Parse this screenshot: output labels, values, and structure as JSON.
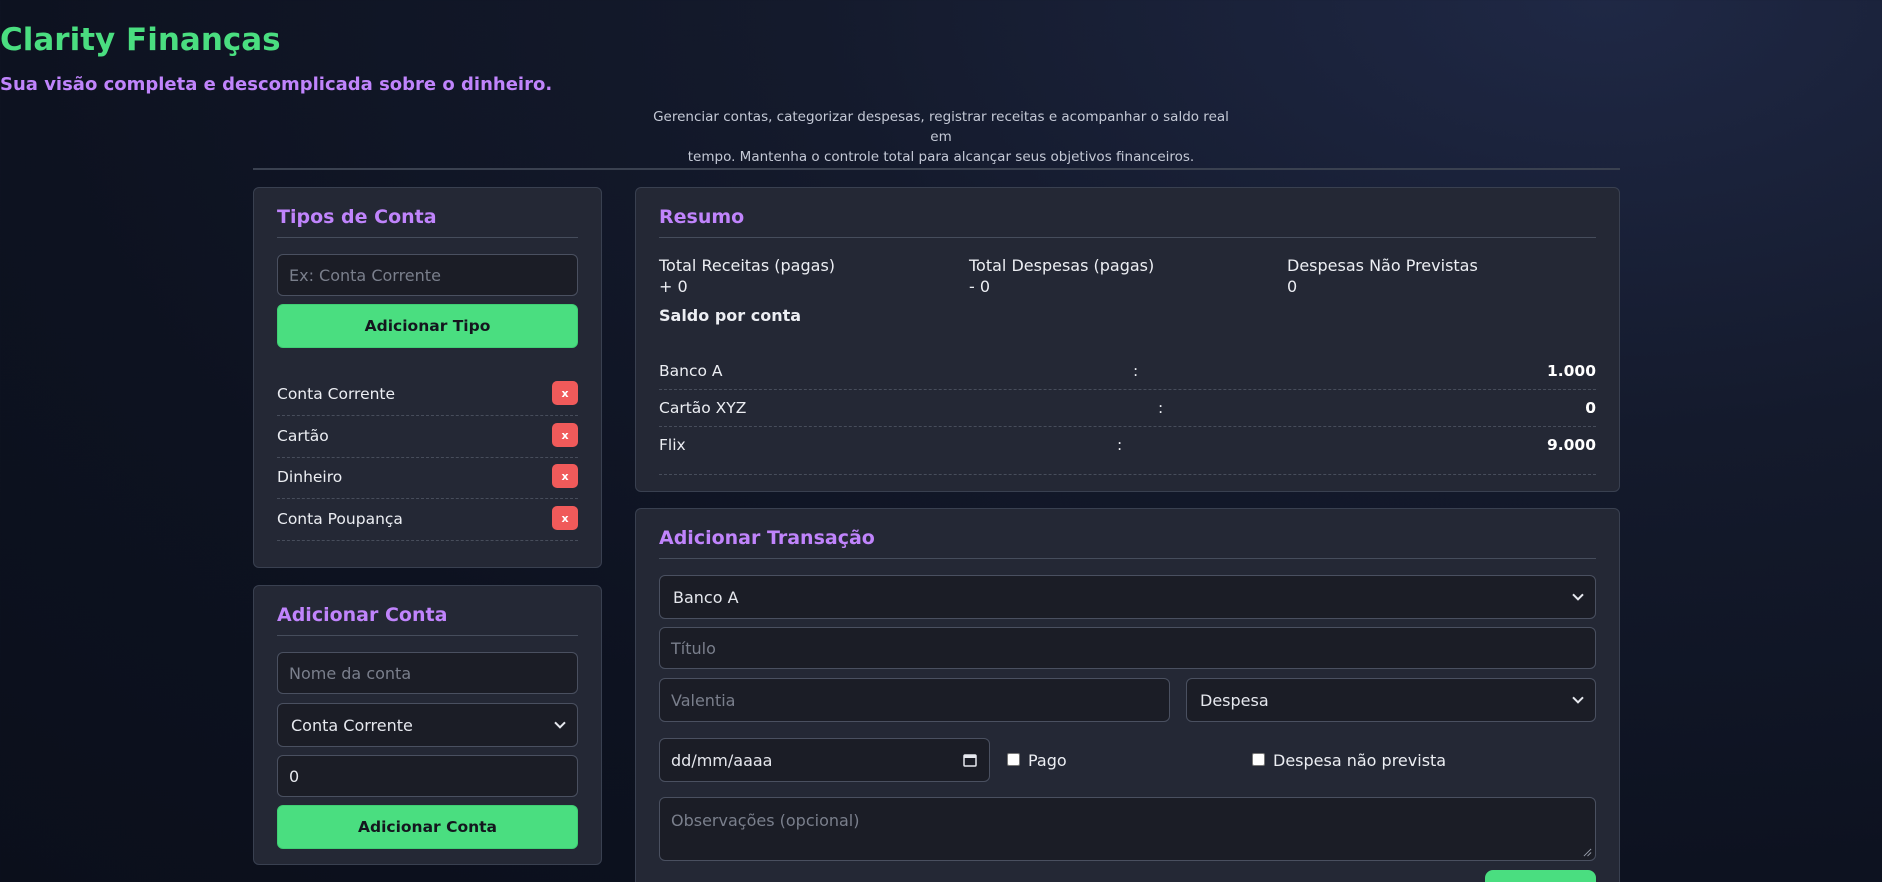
{
  "header": {
    "title": "Clarity Finanças",
    "subtitle": "Sua visão completa e descomplicada sobre o dinheiro.",
    "description_line1": "Gerenciar contas, categorizar despesas, registrar receitas e acompanhar o saldo real em",
    "description_line2": "tempo. Mantenha o controle total para alcançar seus objetivos financeiros."
  },
  "tipos_conta": {
    "title": "Tipos de Conta",
    "input_placeholder": "Ex: Conta Corrente",
    "add_button": "Adicionar Tipo",
    "delete_label": "x",
    "items": [
      "Conta Corrente",
      "Cartão",
      "Dinheiro",
      "Conta Poupança"
    ]
  },
  "adicionar_conta": {
    "title": "Adicionar Conta",
    "name_placeholder": "Nome da conta",
    "type_selected": "Conta Corrente",
    "initial_value": "0",
    "add_button": "Adicionar Conta"
  },
  "resumo": {
    "title": "Resumo",
    "receitas_label": "Total Receitas (pagas)",
    "receitas_value": "+ 0",
    "despesas_label": "Total Despesas (pagas)",
    "despesas_value": "- 0",
    "nao_previstas_label": "Despesas Não Previstas",
    "nao_previstas_value": "0",
    "saldo_label": "Saldo por conta",
    "accounts": [
      {
        "name": "Banco A",
        "sep": ":",
        "balance": "1.000"
      },
      {
        "name": "Cartão XYZ",
        "sep": ":",
        "balance": "0"
      },
      {
        "name": "Flix",
        "sep": ":",
        "balance": "9.000"
      }
    ]
  },
  "transacao": {
    "title": "Adicionar Transação",
    "account_selected": "Banco A",
    "title_placeholder": "Título",
    "value_placeholder": "Valentia",
    "kind_selected": "Despesa",
    "date_placeholder": "dd/mm/aaaa",
    "pago_label": "Pago",
    "nao_prevista_label": "Despesa não prevista",
    "obs_placeholder": "Observações (opcional)"
  },
  "colors": {
    "accent_green": "#4ade80",
    "accent_purple": "#c084fc",
    "danger": "#f05a5a",
    "card_bg": "#242835"
  }
}
